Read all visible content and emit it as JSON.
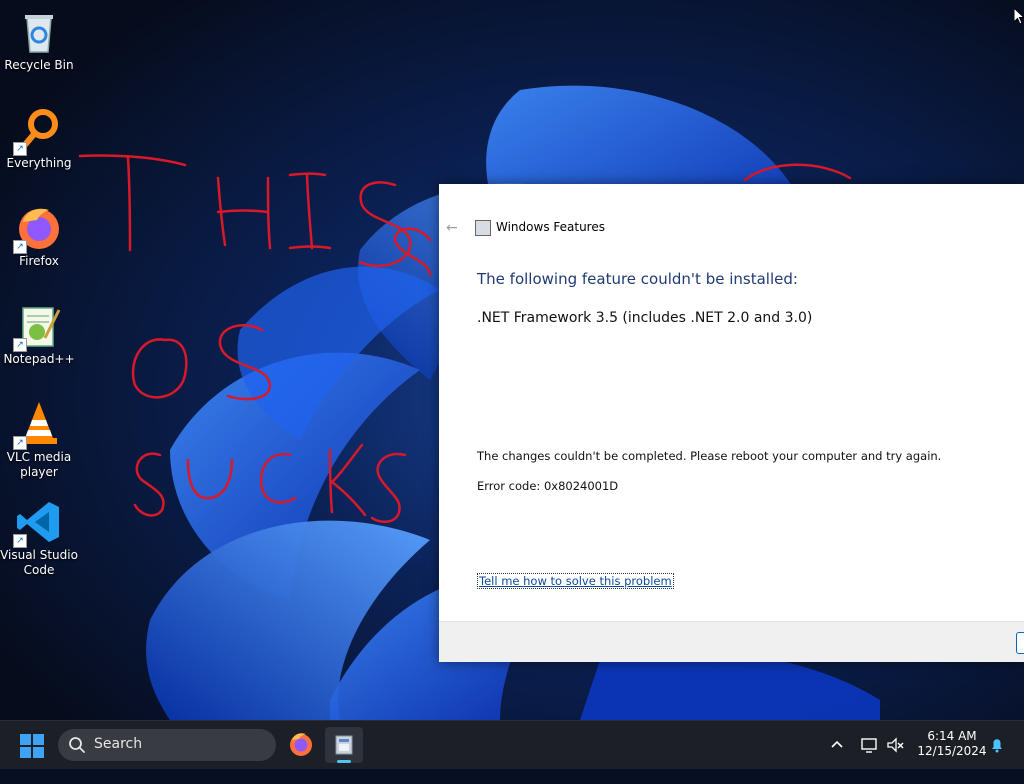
{
  "desktop": {
    "icons": [
      {
        "label": "Recycle Bin",
        "icon": "recycle-bin-icon"
      },
      {
        "label": "Everything",
        "icon": "everything-search-icon"
      },
      {
        "label": "Firefox",
        "icon": "firefox-icon"
      },
      {
        "label": "Notepad++",
        "icon": "notepad-plus-plus-icon"
      },
      {
        "label": "VLC media player",
        "icon": "vlc-icon"
      },
      {
        "label": "Visual Studio Code",
        "icon": "vscode-icon"
      }
    ]
  },
  "dialog": {
    "title": "Windows Features",
    "heading": "The following feature couldn't be installed:",
    "feature": ".NET Framework 3.5 (includes .NET 2.0 and 3.0)",
    "message": "The changes couldn't be completed. Please reboot your computer and try again.",
    "error": "Error code: 0x8024001D",
    "help_link": "Tell me how to solve this problem"
  },
  "taskbar": {
    "search_label": "Search",
    "time": "6:14 AM",
    "date": "12/15/2024"
  },
  "colors": {
    "accent": "#0067c0",
    "heading": "#1f3b74",
    "taskbar": "#1c1f26"
  }
}
